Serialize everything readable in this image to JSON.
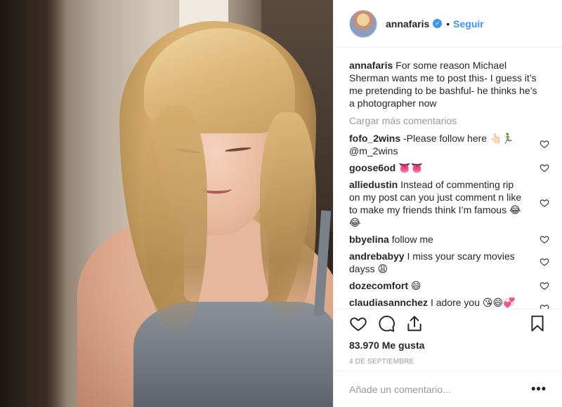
{
  "post": {
    "author": {
      "username": "annafaris",
      "verified_badge": "✓",
      "separator": "•",
      "follow_label": "Seguir"
    },
    "caption": {
      "username": "annafaris",
      "text": "For some reason Michael Sherman wants me to post this- I guess it’s me pretending to be bashful- he thinks he’s a photographer now"
    },
    "load_more_label": "Cargar más comentarios",
    "comments": [
      {
        "username": "fofo_2wins",
        "text": "-Please follow here 👆🏻🏃‍♂️ @m_2wins"
      },
      {
        "username": "goose6od",
        "text": "👅👅"
      },
      {
        "username": "alliedustin",
        "text": "Instead of commenting rip on my post can you just comment n like to make my friends think I’m famous 😂😂"
      },
      {
        "username": "bbyelina",
        "text": "follow me"
      },
      {
        "username": "andrebabyy",
        "text": "I miss your scary movies dayss 😩"
      },
      {
        "username": "dozecomfort",
        "text": "😄"
      },
      {
        "username": "claudiasannchez",
        "text": "I adore you 😘😄💞💞"
      }
    ],
    "likes": "83.970 Me gusta",
    "date": "4 DE SEPTIEMBRE",
    "add_comment_placeholder": "Añade un comentario...",
    "more_label": "•••",
    "icons": {
      "like": "heart-outline-icon",
      "comment": "comment-bubble-icon",
      "share": "share-upload-icon",
      "save": "bookmark-icon",
      "comment_like": "small-heart-icon"
    },
    "colors": {
      "link_blue": "#3897f0",
      "muted_gray": "#999999",
      "text": "#262626",
      "border": "#efefef"
    }
  }
}
